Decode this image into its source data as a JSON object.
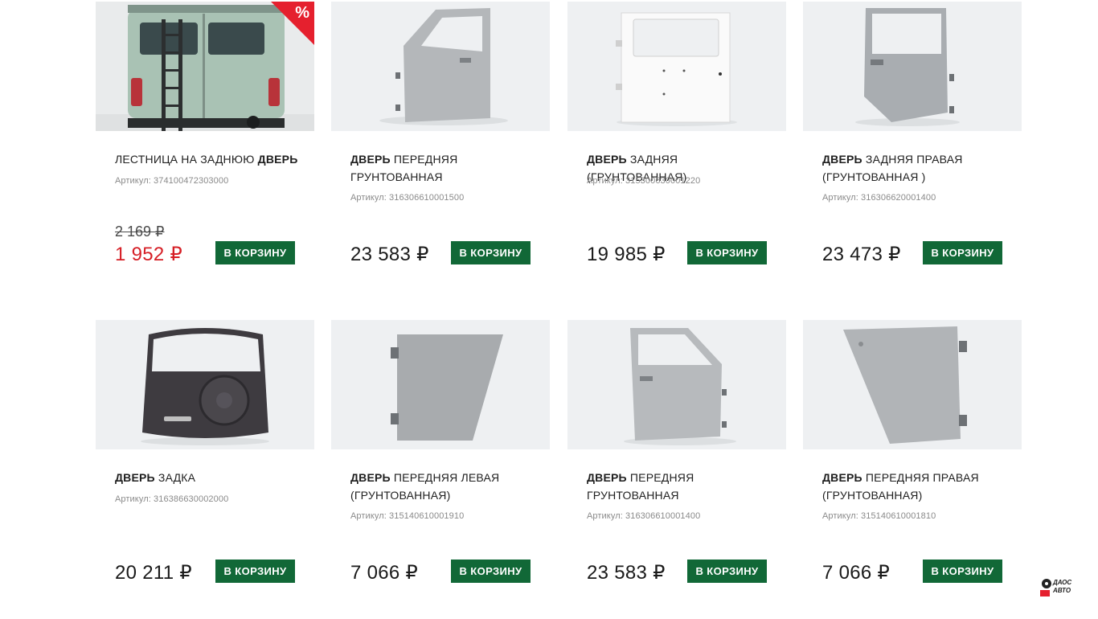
{
  "products": [
    {
      "title_plain": "ЛЕСТНИЦА НА ЗАДНЮЮ ",
      "title_bold": "ДВЕРЬ",
      "title_rest": "",
      "sku": "Артикул: 374100472303000",
      "old_price": "2 169 ₽",
      "price": "1 952 ₽",
      "button": "В КОРЗИНУ",
      "badge": "%",
      "image": "van-rear-ladder"
    },
    {
      "title_plain": "",
      "title_bold": "ДВЕРЬ",
      "title_rest": " ПЕРЕДНЯЯ ГРУНТОВАННАЯ",
      "sku": "Артикул: 316306610001500",
      "price": "23 583 ₽",
      "button": "В КОРЗИНУ",
      "image": "front-door-left"
    },
    {
      "title_plain": "",
      "title_bold": "ДВЕРЬ",
      "title_rest": " ЗАДНЯЯ (ГРУНТОВАННАЯ)",
      "sku": "Артикул: 315300630001220",
      "price": "19 985 ₽",
      "button": "В КОРЗИНУ",
      "image": "rear-door-white"
    },
    {
      "title_plain": "",
      "title_bold": "ДВЕРЬ",
      "title_rest": " ЗАДНЯЯ ПРАВАЯ (ГРУНТОВАННАЯ )",
      "sku": "Артикул: 316306620001400",
      "price": "23 473 ₽",
      "button": "В КОРЗИНУ",
      "image": "rear-door-right"
    },
    {
      "title_plain": "",
      "title_bold": "ДВЕРЬ",
      "title_rest": " ЗАДКА",
      "sku": "Артикул: 316386630002000",
      "price": "20 211 ₽",
      "button": "В КОРЗИНУ",
      "image": "tailgate"
    },
    {
      "title_plain": "",
      "title_bold": "ДВЕРЬ",
      "title_rest": " ПЕРЕДНЯЯ ЛЕВАЯ (ГРУНТОВАННАЯ)",
      "sku": "Артикул: 315140610001910",
      "price": "7 066 ₽",
      "button": "В КОРЗИНУ",
      "image": "door-panel-left"
    },
    {
      "title_plain": "",
      "title_bold": "ДВЕРЬ",
      "title_rest": " ПЕРЕДНЯЯ ГРУНТОВАННАЯ",
      "sku": "Артикул: 316306610001400",
      "price": "23 583 ₽",
      "button": "В КОРЗИНУ",
      "image": "front-door-right"
    },
    {
      "title_plain": "",
      "title_bold": "ДВЕРЬ",
      "title_rest": " ПЕРЕДНЯЯ ПРАВАЯ (ГРУНТОВАННАЯ)",
      "sku": "Артикул: 315140610001810",
      "price": "7 066 ₽",
      "button": "В КОРЗИНУ",
      "image": "door-panel-right"
    }
  ],
  "watermark": {
    "text": "ДАОС АВТО"
  },
  "colors": {
    "button_bg": "#116837",
    "sale_price": "#d61f26",
    "badge_bg": "#e5202e",
    "image_bg": "#eef0f2"
  }
}
